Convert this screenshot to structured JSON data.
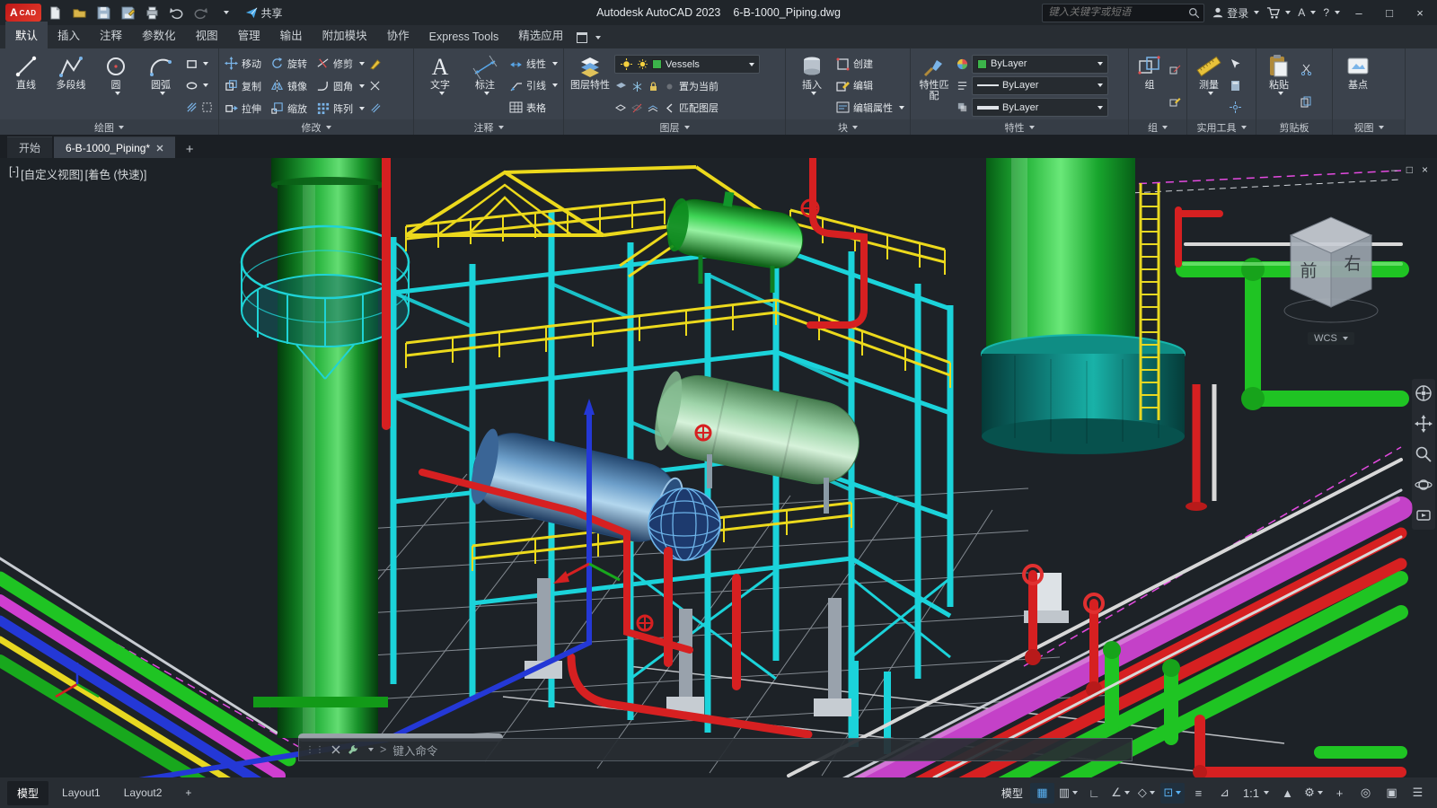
{
  "titlebar": {
    "logo": "A",
    "logo_sub": "CAD",
    "share": "共享",
    "app_title": "Autodesk AutoCAD 2023",
    "doc_title": "6-B-1000_Piping.dwg",
    "search_placeholder": "键入关键字或短语",
    "login": "登录",
    "autodesk_glyph": "A",
    "help_glyph": "?",
    "window": {
      "min": "–",
      "max": "□",
      "close": "×"
    }
  },
  "ribbon_tabs": [
    {
      "label": "默认",
      "active": true
    },
    {
      "label": "插入"
    },
    {
      "label": "注释"
    },
    {
      "label": "参数化"
    },
    {
      "label": "视图"
    },
    {
      "label": "管理"
    },
    {
      "label": "输出"
    },
    {
      "label": "附加模块"
    },
    {
      "label": "协作"
    },
    {
      "label": "Express Tools"
    },
    {
      "label": "精选应用"
    }
  ],
  "panels": {
    "draw": {
      "label": "绘图",
      "line": "直线",
      "polyline": "多段线",
      "circle": "圆",
      "arc": "圆弧"
    },
    "modify": {
      "label": "修改",
      "move": "移动",
      "copy": "复制",
      "stretch": "拉伸",
      "rotate": "旋转",
      "mirror": "镜像",
      "scale": "缩放",
      "trim": "修剪",
      "fillet": "圆角",
      "array": "阵列"
    },
    "annotation": {
      "label": "注释",
      "text": "文字",
      "dim": "标注",
      "linear": "线性",
      "leader": "引线",
      "table": "表格",
      "text_glyph": "A"
    },
    "layers": {
      "label": "图层",
      "props": "图层特性",
      "current": "Vessels",
      "set_current": "置为当前",
      "match": "匹配图层"
    },
    "block": {
      "label": "块",
      "insert": "插入",
      "create": "创建",
      "edit": "编辑",
      "edit_attr": "编辑属性"
    },
    "properties": {
      "label": "特性",
      "match": "特性匹配",
      "bylayer1": "ByLayer",
      "bylayer2": "ByLayer",
      "bylayer3": "ByLayer"
    },
    "groups": {
      "label": "组",
      "group": "组"
    },
    "utilities": {
      "label": "实用工具",
      "measure": "测量"
    },
    "clipboard": {
      "label": "剪贴板",
      "paste": "粘贴"
    },
    "view": {
      "label": "视图",
      "base": "基点"
    }
  },
  "file_tabs": {
    "start": "开始",
    "doc": "6-B-1000_Piping*",
    "add": "+"
  },
  "viewport": {
    "vp_min": "[-]",
    "view_name": "[自定义视图]",
    "style": "[着色 (快速)]",
    "viewcube": {
      "front": "前",
      "right": "右",
      "wcs": "WCS"
    },
    "window": {
      "min": "–",
      "max": "□",
      "close": "×"
    },
    "command": {
      "prompt": ">",
      "placeholder": "键入命令"
    }
  },
  "statusbar": {
    "model_tab": "模型",
    "layout1": "Layout1",
    "layout2": "Layout2",
    "add_layout": "+",
    "model_label": "模型",
    "scale": "1:1",
    "icons": [
      {
        "name": "grid",
        "glyph": "▦"
      },
      {
        "name": "snap",
        "glyph": "▥"
      },
      {
        "name": "ortho",
        "glyph": "∟"
      },
      {
        "name": "polar",
        "glyph": "∠"
      },
      {
        "name": "isometric",
        "glyph": "◇"
      },
      {
        "name": "osnap",
        "glyph": "⊡"
      },
      {
        "name": "lineweight",
        "glyph": "≡"
      },
      {
        "name": "dynamic-ucs",
        "glyph": "⊿"
      },
      {
        "name": "workspace",
        "glyph": "⚙"
      },
      {
        "name": "annotation-monitor",
        "glyph": "+"
      },
      {
        "name": "isolate",
        "glyph": "◎"
      },
      {
        "name": "graphics",
        "glyph": "▲"
      },
      {
        "name": "clean-screen",
        "glyph": "▣"
      },
      {
        "name": "customize",
        "glyph": "☰"
      }
    ]
  },
  "colors": {
    "accent_blue": "#3aa0e8",
    "layer_green": "#3cb44a"
  }
}
